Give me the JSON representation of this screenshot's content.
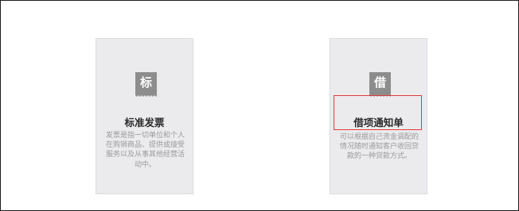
{
  "cards": [
    {
      "icon_char": "标",
      "icon_name": "ticket-icon",
      "title": "标准发票",
      "description": "发票是指一切单位和个人在购销商品、提供或接受服务以及从事其他经营活动中。"
    },
    {
      "icon_char": "借",
      "icon_name": "ticket-icon",
      "title": "借项通知单",
      "description": "可以根据自己资金调配的情况随时通知客户收回贷款的一种贷款方式。"
    }
  ],
  "colors": {
    "card_bg": "#ebebee",
    "icon_bg": "#8d8d8d",
    "highlight": "#e03a3a"
  }
}
